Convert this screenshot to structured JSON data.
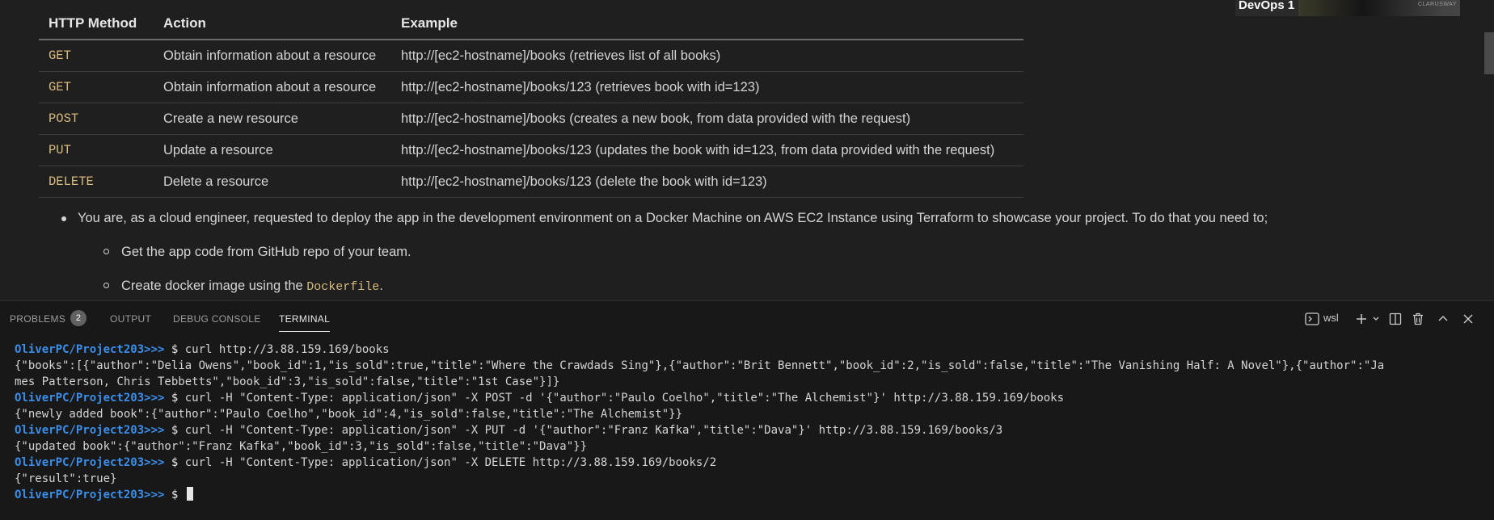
{
  "webcam": {
    "label": "DevOps 1",
    "logo_text": "CLARUSWAY"
  },
  "table": {
    "headers": [
      "HTTP Method",
      "Action",
      "Example"
    ],
    "rows": [
      {
        "method": "GET",
        "action": "Obtain information about a resource",
        "example": "http://[ec2-hostname]/books (retrieves list of all books)"
      },
      {
        "method": "GET",
        "action": "Obtain information about a resource",
        "example": "http://[ec2-hostname]/books/123 (retrieves book with id=123)"
      },
      {
        "method": "POST",
        "action": "Create a new resource",
        "example": "http://[ec2-hostname]/books (creates a new book, from data provided with the request)"
      },
      {
        "method": "PUT",
        "action": "Update a resource",
        "example": "http://[ec2-hostname]/books/123 (updates the book with id=123, from data provided with the request)"
      },
      {
        "method": "DELETE",
        "action": "Delete a resource",
        "example": "http://[ec2-hostname]/books/123 (delete the book with id=123)"
      }
    ]
  },
  "bullets": {
    "main": "You are, as a cloud engineer, requested to deploy the app in the development environment on a Docker Machine on AWS EC2 Instance using Terraform to showcase your project. To do that you need to;",
    "sub1": "Get the app code from GitHub repo of your team.",
    "sub2_prefix": "Create docker image using the ",
    "sub2_code": "Dockerfile",
    "sub2_suffix": "."
  },
  "panel": {
    "tabs": {
      "problems": "PROBLEMS",
      "problems_count": "2",
      "output": "OUTPUT",
      "debug": "DEBUG CONSOLE",
      "terminal": "TERMINAL"
    },
    "shell_name": "wsl",
    "icons": [
      "terminal-icon",
      "plus-icon",
      "chevron-down-icon",
      "split-icon",
      "trash-icon",
      "chevron-up-icon",
      "close-icon"
    ]
  },
  "terminal": {
    "prompt": "OliverPC/Project203>>> ",
    "dollar": "$ ",
    "lines": [
      {
        "type": "cmd",
        "text": "curl http://3.88.159.169/books"
      },
      {
        "type": "out",
        "text": "{\"books\":[{\"author\":\"Delia Owens\",\"book_id\":1,\"is_sold\":true,\"title\":\"Where the Crawdads Sing\"},{\"author\":\"Brit Bennett\",\"book_id\":2,\"is_sold\":false,\"title\":\"The Vanishing Half: A Novel\"},{\"author\":\"Ja"
      },
      {
        "type": "out",
        "text": "mes Patterson, Chris Tebbetts\",\"book_id\":3,\"is_sold\":false,\"title\":\"1st Case\"}]}"
      },
      {
        "type": "cmd",
        "text": "curl -H \"Content-Type: application/json\" -X POST -d '{\"author\":\"Paulo Coelho\",\"title\":\"The Alchemist\"}' http://3.88.159.169/books"
      },
      {
        "type": "out",
        "text": "{\"newly added book\":{\"author\":\"Paulo Coelho\",\"book_id\":4,\"is_sold\":false,\"title\":\"The Alchemist\"}}"
      },
      {
        "type": "cmd",
        "text": "curl -H \"Content-Type: application/json\" -X PUT -d '{\"author\":\"Franz Kafka\",\"title\":\"Dava\"}' http://3.88.159.169/books/3"
      },
      {
        "type": "out",
        "text": "{\"updated book\":{\"author\":\"Franz Kafka\",\"book_id\":3,\"is_sold\":false,\"title\":\"Dava\"}}"
      },
      {
        "type": "cmd",
        "text": "curl -H \"Content-Type: application/json\" -X DELETE http://3.88.159.169/books/2"
      },
      {
        "type": "out",
        "text": "{\"result\":true}"
      },
      {
        "type": "cmd",
        "text": ""
      }
    ]
  }
}
